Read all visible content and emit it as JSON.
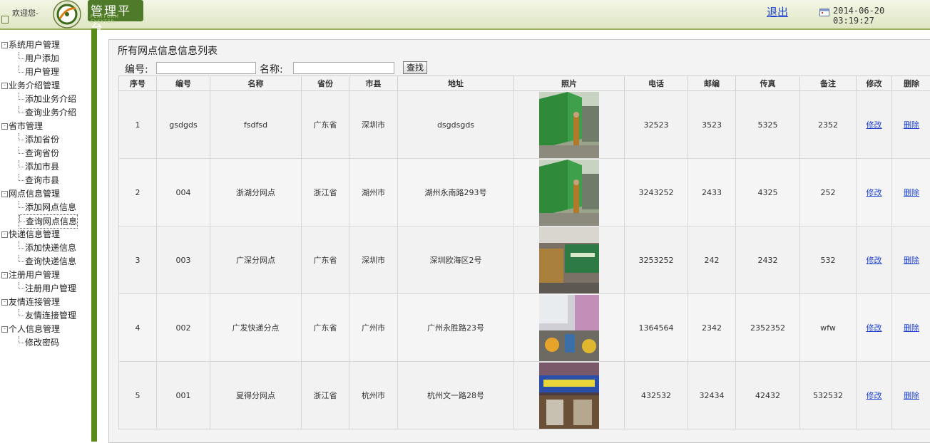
{
  "header": {
    "welcome": "欢迎您-",
    "brand_title": "管理平台",
    "brand_subtitle": "PLATFORM SYSYTER",
    "logout": "退出",
    "datetime": "2014-06-20 03:19:27"
  },
  "sidebar": {
    "groups": [
      {
        "label": "系统用户管理",
        "items": [
          "用户添加",
          "用户管理"
        ]
      },
      {
        "label": "业务介绍管理",
        "items": [
          "添加业务介绍",
          "查询业务介绍"
        ]
      },
      {
        "label": "省市管理",
        "items": [
          "添加省份",
          "查询省份",
          "添加市县",
          "查询市县"
        ]
      },
      {
        "label": "网点信息管理",
        "items": [
          "添加网点信息",
          "查询网点信息"
        ]
      },
      {
        "label": "快递信息管理",
        "items": [
          "添加快递信息",
          "查询快递信息"
        ]
      },
      {
        "label": "注册用户管理",
        "items": [
          "注册用户管理"
        ]
      },
      {
        "label": "友情连接管理",
        "items": [
          "友情连接管理"
        ]
      },
      {
        "label": "个人信息管理",
        "items": [
          "修改密码"
        ]
      }
    ],
    "expand_symbol": "-"
  },
  "main": {
    "title": "所有网点信息信息列表",
    "search": {
      "code_label": "编号:",
      "code_value": "",
      "name_label": "名称:",
      "name_value": "",
      "button": "查找"
    },
    "columns": [
      "序号",
      "编号",
      "名称",
      "省份",
      "市县",
      "地址",
      "照片",
      "电话",
      "邮编",
      "传真",
      "备注",
      "修改",
      "删除"
    ],
    "rows": [
      {
        "seq": "1",
        "code": "gsdgds",
        "name": "fsdfsd",
        "province": "广东省",
        "city": "深圳市",
        "address": "dsgdsgds",
        "photo": "truck",
        "phone": "32523",
        "zip": "3523",
        "fax": "5325",
        "note": "2352",
        "edit": "修改",
        "delete": "删除"
      },
      {
        "seq": "2",
        "code": "004",
        "name": "浙湖分网点",
        "province": "浙江省",
        "city": "湖州市",
        "address": "湖州永南路293号",
        "photo": "truck",
        "phone": "3243252",
        "zip": "2433",
        "fax": "4325",
        "note": "252",
        "edit": "修改",
        "delete": "删除"
      },
      {
        "seq": "3",
        "code": "003",
        "name": "广深分网点",
        "province": "广东省",
        "city": "深圳市",
        "address": "深圳欧海区2号",
        "photo": "warehouse",
        "phone": "3253252",
        "zip": "242",
        "fax": "2432",
        "note": "532",
        "edit": "修改",
        "delete": "删除"
      },
      {
        "seq": "4",
        "code": "002",
        "name": "广发快递分点",
        "province": "广东省",
        "city": "广州市",
        "address": "广州永胜路23号",
        "photo": "street",
        "phone": "1364564",
        "zip": "2342",
        "fax": "2352352",
        "note": "wfw",
        "edit": "修改",
        "delete": "删除"
      },
      {
        "seq": "5",
        "code": "001",
        "name": "夏得分网点",
        "province": "浙江省",
        "city": "杭州市",
        "address": "杭州文一路28号",
        "photo": "storefront",
        "phone": "432532",
        "zip": "32434",
        "fax": "42432",
        "note": "532532",
        "edit": "修改",
        "delete": "删除"
      }
    ]
  },
  "colors": {
    "accent_green": "#5a8a18",
    "link_blue": "#1b3fd0"
  }
}
